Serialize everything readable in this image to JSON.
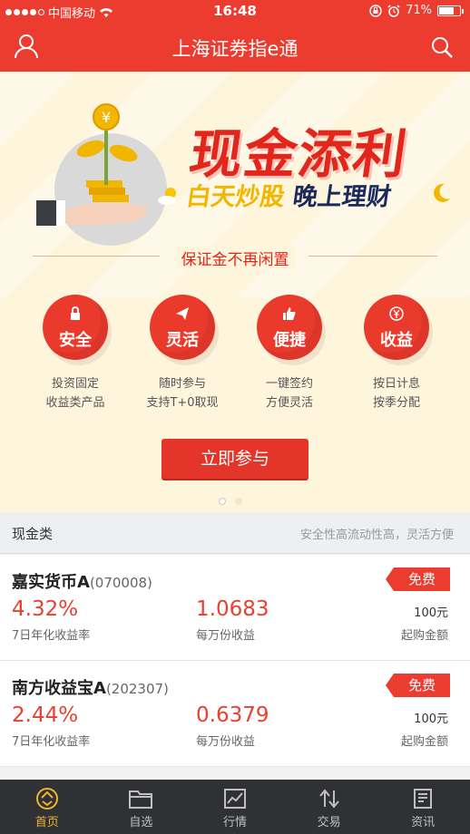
{
  "status": {
    "carrier": "中国移动",
    "time": "16:48",
    "battery": "71%",
    "battery_level": 0.71
  },
  "header": {
    "title": "上海证券指e通"
  },
  "banner": {
    "title": "现金添利",
    "sub_day": "白天炒股",
    "sub_night": "晚上理财",
    "slogan": "保证金不再闲置",
    "features": [
      {
        "label": "安全",
        "desc1": "投资固定",
        "desc2": "收益类产品",
        "icon": "lock-icon"
      },
      {
        "label": "灵活",
        "desc1": "随时参与",
        "desc2": "支持T+0取现",
        "icon": "paper-plane-icon"
      },
      {
        "label": "便捷",
        "desc1": "一键签约",
        "desc2": "方便灵活",
        "icon": "thumbs-up-icon"
      },
      {
        "label": "收益",
        "desc1": "按日计息",
        "desc2": "按季分配",
        "icon": "yen-coin-icon"
      }
    ],
    "button": "立即参与"
  },
  "section": {
    "title": "现金类",
    "subtitle": "安全性高流动性高，灵活方便"
  },
  "funds": [
    {
      "name": "嘉实货币A",
      "code": "(070008)",
      "badge": "免费",
      "rate": "4.32%",
      "rate_label": "7日年化收益率",
      "income": "1.0683",
      "income_label": "每万份收益",
      "min": "100元",
      "min_label": "起购金额"
    },
    {
      "name": "南方收益宝A",
      "code": "(202307)",
      "badge": "免费",
      "rate": "2.44%",
      "rate_label": "7日年化收益率",
      "income": "0.6379",
      "income_label": "每万份收益",
      "min": "100元",
      "min_label": "起购金额"
    }
  ],
  "nav": [
    {
      "label": "首页",
      "icon": "home-icon",
      "active": true
    },
    {
      "label": "自选",
      "icon": "folder-icon"
    },
    {
      "label": "行情",
      "icon": "chart-icon"
    },
    {
      "label": "交易",
      "icon": "trade-arrows-icon"
    },
    {
      "label": "资讯",
      "icon": "news-icon"
    }
  ],
  "colors": {
    "brand_red": "#ec3b2f",
    "banner_bg": "#fdf5dc",
    "nav_bg": "#2f3135",
    "nav_active": "#f0b330"
  }
}
